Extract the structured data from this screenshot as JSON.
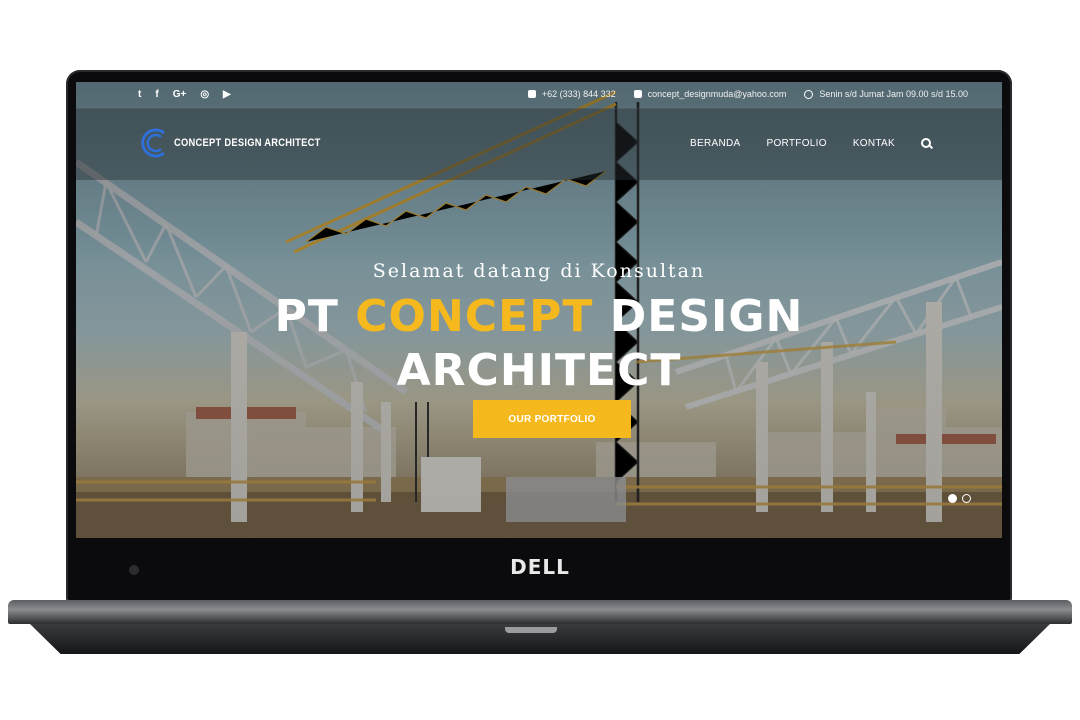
{
  "brand": "DELL",
  "topbar": {
    "social": [
      "twitter-icon",
      "facebook-icon",
      "google-plus-icon",
      "instagram-icon",
      "youtube-icon"
    ],
    "social_glyphs": [
      "t",
      "f",
      "G+",
      "◎",
      "▶"
    ],
    "phone": "+62 (333) 844 332",
    "email": "concept_designmuda@yahoo.com",
    "hours": "Senin s/d Jumat Jam 09.00 s/d 15.00"
  },
  "header": {
    "logo_text": "CONCEPT DESIGN ARCHITECT",
    "nav": [
      "BERANDA",
      "PORTFOLIO",
      "KONTAK"
    ]
  },
  "hero": {
    "subtitle": "Selamat datang di Konsultan",
    "title_prefix": "PT",
    "title_accent": "CONCEPT",
    "title_rest": "DESIGN",
    "title_line2": "ARCHITECT",
    "cta": "OUR PORTFOLIO"
  },
  "slider": {
    "current": 1,
    "total": 2
  },
  "colors": {
    "accent": "#f5b91d",
    "logo_blue": "#2e6fd8"
  }
}
